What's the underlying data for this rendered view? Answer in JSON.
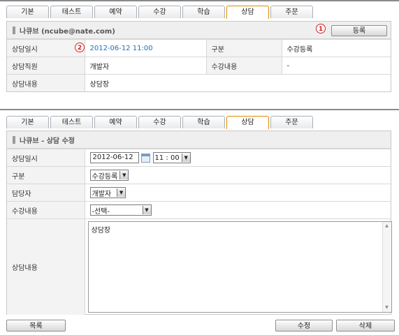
{
  "tabs": [
    "기본",
    "테스트",
    "예약",
    "수강",
    "학습",
    "상담",
    "주문"
  ],
  "view": {
    "header_title": "나큐브 (ncube@nate.com)",
    "register_button": "등록",
    "badge1": "1",
    "badge2": "2",
    "rows": {
      "datetime_label": "상담일시",
      "datetime_value": "2012-06-12 11:00",
      "category_label": "구분",
      "category_value": "수강등록",
      "staff_label": "상담직원",
      "staff_value": "개발자",
      "course_label": "수강내용",
      "course_value": "-",
      "content_label": "상담내용",
      "content_value": "상담장"
    }
  },
  "edit": {
    "header_title": "나큐브 - 상담 수정",
    "datetime_label": "상담일시",
    "date_value": "2012-06-12",
    "time_value": "11 : 00",
    "category_label": "구분",
    "category_value": "수강등록",
    "manager_label": "담당자",
    "manager_value": "개발자",
    "course_label": "수강내용",
    "course_value": "-선택-",
    "content_label": "상담내용",
    "content_value": "상담장"
  },
  "buttons": {
    "list": "목록",
    "edit": "수정",
    "delete": "삭제"
  }
}
